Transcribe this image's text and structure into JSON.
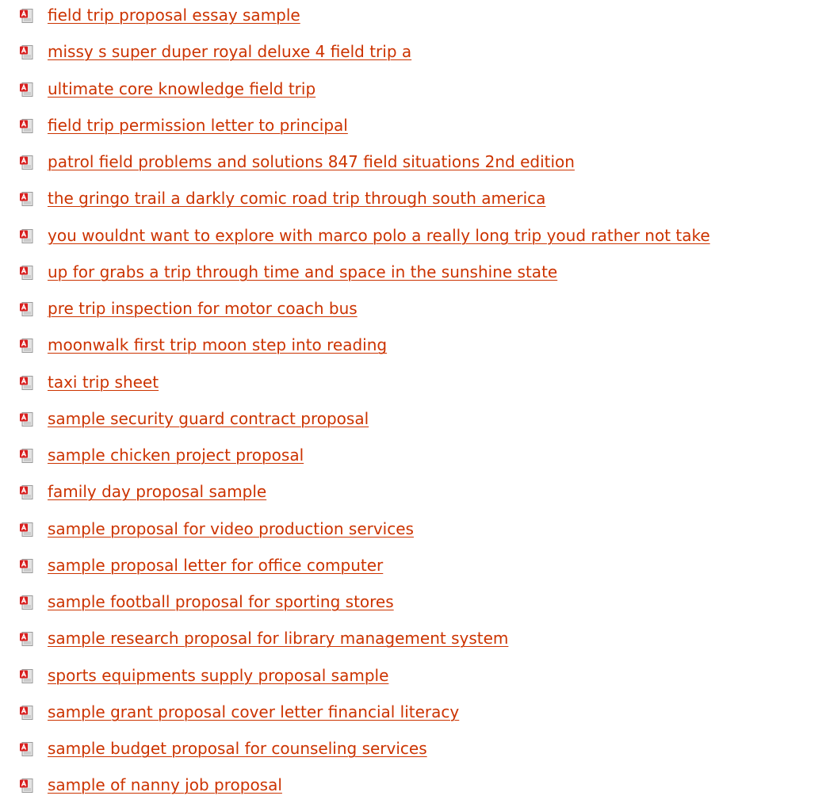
{
  "link_color": "#cc3300",
  "icon": "pdf-document-icon",
  "items": [
    {
      "label": "field trip proposal essay sample"
    },
    {
      "label": "missy s super duper royal deluxe 4 field trip a"
    },
    {
      "label": "ultimate core knowledge field trip"
    },
    {
      "label": "field trip permission letter to principal"
    },
    {
      "label": "patrol field problems and solutions 847 field situations 2nd edition"
    },
    {
      "label": "the gringo trail a darkly comic road trip through south america"
    },
    {
      "label": "you wouldnt want to explore with marco polo a really long trip youd rather not take"
    },
    {
      "label": "up for grabs a trip through time and space in the sunshine state"
    },
    {
      "label": "pre trip inspection for motor coach bus"
    },
    {
      "label": "moonwalk first trip moon step into reading"
    },
    {
      "label": "taxi trip sheet"
    },
    {
      "label": "sample security guard contract proposal"
    },
    {
      "label": "sample chicken project proposal"
    },
    {
      "label": "family day proposal sample"
    },
    {
      "label": "sample proposal for video production services"
    },
    {
      "label": "sample proposal letter for office computer"
    },
    {
      "label": "sample football proposal for sporting stores"
    },
    {
      "label": "sample research proposal for library management system"
    },
    {
      "label": "sports equipments supply proposal sample"
    },
    {
      "label": "sample grant proposal cover letter financial literacy"
    },
    {
      "label": "sample budget proposal for counseling services"
    },
    {
      "label": "sample of nanny job proposal"
    }
  ]
}
